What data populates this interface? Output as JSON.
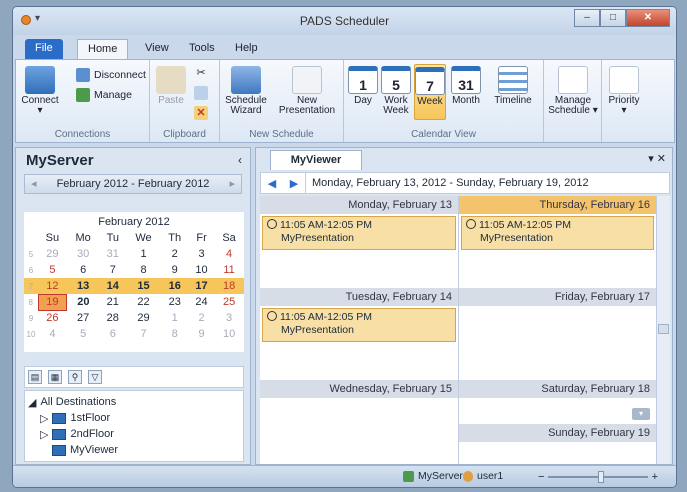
{
  "window": {
    "title": "PADS Scheduler",
    "min": "–",
    "max": "□",
    "close": "✕"
  },
  "tabs": [
    {
      "label": "File"
    },
    {
      "label": "Home"
    },
    {
      "label": "View"
    },
    {
      "label": "Tools"
    },
    {
      "label": "Help"
    }
  ],
  "ribbon": {
    "connections": {
      "label": "Connections",
      "connect": "Connect",
      "disconnect": "Disconnect",
      "manage": "Manage"
    },
    "clipboard": {
      "label": "Clipboard",
      "paste": "Paste"
    },
    "new_schedule": {
      "label": "New Schedule",
      "wizard": "Schedule Wizard",
      "presentation": "New Presentation"
    },
    "calendar_view": {
      "label": "Calendar View",
      "day": "Day",
      "workweek": "Work Week",
      "week": "Week",
      "month": "Month",
      "timeline": "Timeline",
      "day_num": "1",
      "ww_num": "5",
      "week_num": "7",
      "month_num": "31"
    },
    "manage_schedule": "Manage Schedule ▾",
    "priority": "Priority"
  },
  "left": {
    "server": "MyServer",
    "collapse": "‹",
    "range": "February 2012 - February 2012",
    "month": "February 2012",
    "weekdays": [
      "Su",
      "Mo",
      "Tu",
      "We",
      "Th",
      "Fr",
      "Sa"
    ],
    "weeks": [
      {
        "wk": "5",
        "days": [
          "29",
          "30",
          "31",
          "1",
          "2",
          "3",
          "4"
        ]
      },
      {
        "wk": "6",
        "days": [
          "5",
          "6",
          "7",
          "8",
          "9",
          "10",
          "11"
        ]
      },
      {
        "wk": "7",
        "days": [
          "12",
          "13",
          "14",
          "15",
          "16",
          "17",
          "18"
        ]
      },
      {
        "wk": "8",
        "days": [
          "19",
          "20",
          "21",
          "22",
          "23",
          "24",
          "25"
        ]
      },
      {
        "wk": "9",
        "days": [
          "26",
          "27",
          "28",
          "29",
          "1",
          "2",
          "3"
        ]
      },
      {
        "wk": "10",
        "days": [
          "4",
          "5",
          "6",
          "7",
          "8",
          "9",
          "10"
        ]
      }
    ],
    "tree": {
      "root": "All Destinations",
      "items": [
        "1stFloor",
        "2ndFloor",
        "MyViewer"
      ]
    }
  },
  "right": {
    "tab": "MyViewer",
    "range": "Monday, February 13, 2012 - Sunday, February 19, 2012",
    "days": {
      "mon": "Monday, February 13",
      "thu": "Thursday, February 16",
      "tue": "Tuesday, February 14",
      "fri": "Friday, February 17",
      "wed": "Wednesday, February 15",
      "sat": "Saturday, February 18",
      "sun": "Sunday, February 19"
    },
    "appt_time": "11:05 AM-12:05 PM",
    "appt_name": "MyPresentation"
  },
  "status": {
    "server": "MyServer",
    "user": "user1",
    "zoom_minus": "−",
    "zoom_plus": "+"
  },
  "colors": {
    "accent": "#2a6cc8",
    "today": "#f3c46c",
    "appointment": "#f7dfa6",
    "weekend": "#c0392b"
  }
}
